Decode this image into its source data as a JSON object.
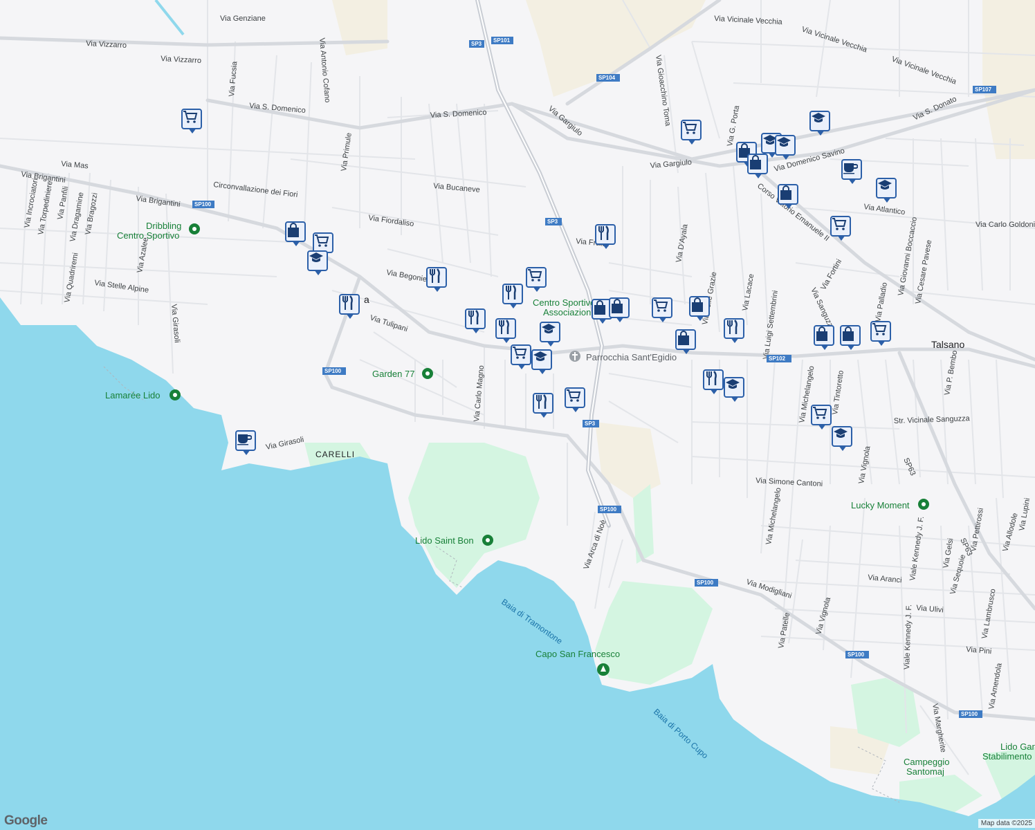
{
  "map": {
    "colors": {
      "land": "#f5f5f7",
      "water": "#8fd8ec",
      "park": "#d4f5e1",
      "farm": "#f3efe2",
      "road": "#dfe1e6",
      "highway": "#c9cdd4",
      "pin_border": "#2b5fa8",
      "pin_bg": "#eaf0fb",
      "poi": "#188038"
    },
    "streets": [
      "Via Genziane",
      "Via Vizzarro",
      "Via Vizzarro",
      "Via Antonio Cofano",
      "Via Fucsia",
      "Via S. Domenico",
      "Via S. Domenico",
      "Via Primule",
      "Via Mas",
      "Via Brigantini",
      "Via Brigantini",
      "Circonvallazione dei Fiori",
      "Via Bucaneve",
      "Via Fiordaliso",
      "Via Begonie",
      "Via Tulipani",
      "Via Stelle Alpine",
      "Via Girasoli",
      "Via Girasoli",
      "Via Azalee",
      "Via Incrociatori",
      "Via Torpediniere",
      "Via Panfili",
      "Via Dragamine",
      "Via Bragozzi",
      "Via Quadriremi",
      "Via Carlo Magno",
      "Via Gargiulo",
      "Via Gargiulo",
      "Via Gioacchino Toma",
      "Via Vicinale Vecchia",
      "Via Vicinale Vecchia",
      "Via Vicinale Vecchia",
      "Via G. Porta",
      "Via Domenico Savino",
      "Via S. Donato",
      "Via Atlantico",
      "Via Carlo Goldoni",
      "Corso Vittorio Emanuele II",
      "Via D'Ayala",
      "Via Luigi Settembrini",
      "Via Sanguzza",
      "Via Fortini",
      "Via Giovanni Boccaccio",
      "Via Cesare Pavese",
      "Via Michelangelo",
      "Via Tintoretto",
      "Via P. Bembo",
      "Str. Vicinale Sanguzza",
      "Via Simone Cantoni",
      "Via Vignola",
      "Via Michelangelo",
      "Via Arca di Noè",
      "Via Modigliani",
      "Via Patelle",
      "Via Vignola",
      "Via Aranci",
      "Viale Kennedy J. F.",
      "Via Gelsi",
      "Via Sequoie",
      "Via Pettirossi",
      "Via Allodole",
      "Via Lupini",
      "Via Ulivi",
      "Via Lambrusco",
      "Via Pini",
      "Via Amendola",
      "Viale Kennedy J. F.",
      "Via Margherite",
      "Via Palladio",
      "Via Fratta",
      "Via delle Grazie",
      "Via Lacace"
    ],
    "shields": [
      "SP3",
      "SP101",
      "SP104",
      "SP107",
      "SP100",
      "SP3",
      "SP100",
      "SP3",
      "SP100",
      "SP102",
      "SP100",
      "SP100",
      "SP63",
      "SP63",
      "SP100"
    ],
    "places": {
      "talsano": "Talsano",
      "carelli": "CARELLI",
      "dribbling": "Dribbling\nCentro Sportivo",
      "garden": "Garden 77",
      "lamaree": "Lamarée Lido",
      "lido_saint_bon": "Lido Saint Bon",
      "capo": "Capo San Francesco",
      "baia_tram": "Baia di Tramontone",
      "baia_porto": "Baia di Porto Cupo",
      "parrocchia": "Parrocchia Sant'Egidio",
      "centro_sportivo": "Centro Sportivo\nAssociazione",
      "lucky": "Lucky Moment",
      "campeggio": "Campeggio\nSantomaj",
      "lido_gar": "Lido Gar\nStabilimento Ba",
      "via_frag": "a"
    },
    "attribution": {
      "logo": "Google",
      "data": "Map data ©2025"
    },
    "pins": [
      {
        "icon": "cart-icon"
      },
      {
        "icon": "bag-icon"
      },
      {
        "icon": "cart-icon"
      },
      {
        "icon": "school-icon"
      },
      {
        "icon": "fork-knife-icon"
      },
      {
        "icon": "fork-knife-icon"
      },
      {
        "icon": "cart-icon"
      },
      {
        "icon": "fork-knife-icon"
      },
      {
        "icon": "fork-knife-icon"
      },
      {
        "icon": "fork-knife-icon"
      },
      {
        "icon": "school-icon"
      },
      {
        "icon": "cart-icon"
      },
      {
        "icon": "school-icon"
      },
      {
        "icon": "fork-knife-icon"
      },
      {
        "icon": "cart-icon"
      },
      {
        "icon": "fork-knife-icon"
      },
      {
        "icon": "bag-icon"
      },
      {
        "icon": "bag-icon"
      },
      {
        "icon": "cart-icon"
      },
      {
        "icon": "cart-icon"
      },
      {
        "icon": "bag-icon"
      },
      {
        "icon": "bag-icon"
      },
      {
        "icon": "fork-knife-icon"
      },
      {
        "icon": "fork-knife-icon"
      },
      {
        "icon": "school-icon"
      },
      {
        "icon": "cart-icon"
      },
      {
        "icon": "school-icon"
      },
      {
        "icon": "bag-icon"
      },
      {
        "icon": "bag-icon"
      },
      {
        "icon": "bag-icon"
      },
      {
        "icon": "school-icon"
      },
      {
        "icon": "cup-icon"
      },
      {
        "icon": "school-icon"
      },
      {
        "icon": "cart-icon"
      },
      {
        "icon": "bag-icon"
      },
      {
        "icon": "bag-icon"
      },
      {
        "icon": "cart-icon"
      },
      {
        "icon": "school-icon"
      },
      {
        "icon": "school-icon"
      },
      {
        "icon": "cup-icon"
      }
    ]
  }
}
